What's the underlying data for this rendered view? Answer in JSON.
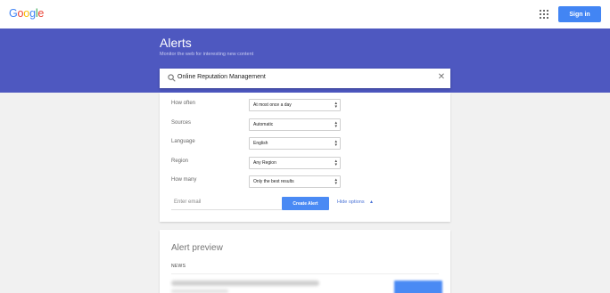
{
  "header": {
    "logo_letters": [
      {
        "char": "G",
        "color": "#4285f4"
      },
      {
        "char": "o",
        "color": "#ea4335"
      },
      {
        "char": "o",
        "color": "#fbbc05"
      },
      {
        "char": "g",
        "color": "#4285f4"
      },
      {
        "char": "l",
        "color": "#34a853"
      },
      {
        "char": "e",
        "color": "#ea4335"
      }
    ],
    "apps_icon": "apps-grid-icon",
    "signin_label": "Sign in"
  },
  "hero": {
    "title": "Alerts",
    "subtitle": "Monitor the web for interesting new content",
    "background": "#4e58c0"
  },
  "search": {
    "icon": "search-icon",
    "value": "Online Reputation Management",
    "clear_icon": "close-icon"
  },
  "options": [
    {
      "label": "How often",
      "value": "At most once a day"
    },
    {
      "label": "Sources",
      "value": "Automatic"
    },
    {
      "label": "Language",
      "value": "English"
    },
    {
      "label": "Region",
      "value": "Any Region"
    },
    {
      "label": "How many",
      "value": "Only the best results"
    }
  ],
  "create": {
    "email_placeholder": "Enter email",
    "button_label": "Create Alert",
    "hide_options_label": "Hide options",
    "accent": "#4a8af4"
  },
  "preview": {
    "title": "Alert preview",
    "section_label": "NEWS"
  }
}
